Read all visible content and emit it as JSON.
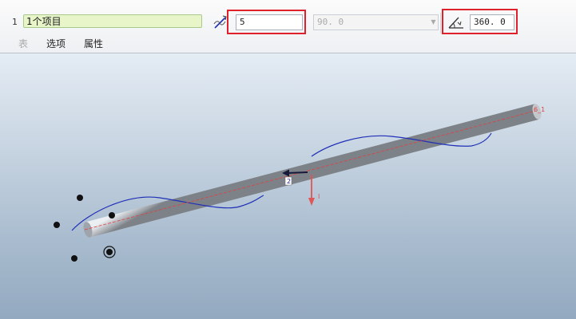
{
  "dashboard": {
    "reference_count": "1",
    "reference_collector": "1个项目",
    "pitch_value": "5",
    "secondary_value": "90. 0",
    "angle_value": "360. 0"
  },
  "tabs": [
    {
      "label": "表",
      "enabled": false
    },
    {
      "label": "选项",
      "enabled": true
    },
    {
      "label": "属性",
      "enabled": true
    }
  ],
  "model": {
    "end_label": "6_1",
    "handle_label": "2",
    "arrow_label": "I",
    "colors": {
      "cylinder": "#b8bcc2",
      "helix": "#1f2fb8",
      "axis_line": "#e04040",
      "arrow": "#e05555",
      "background_top": "#e4ecf4",
      "background_bottom": "#93a9bf"
    }
  }
}
